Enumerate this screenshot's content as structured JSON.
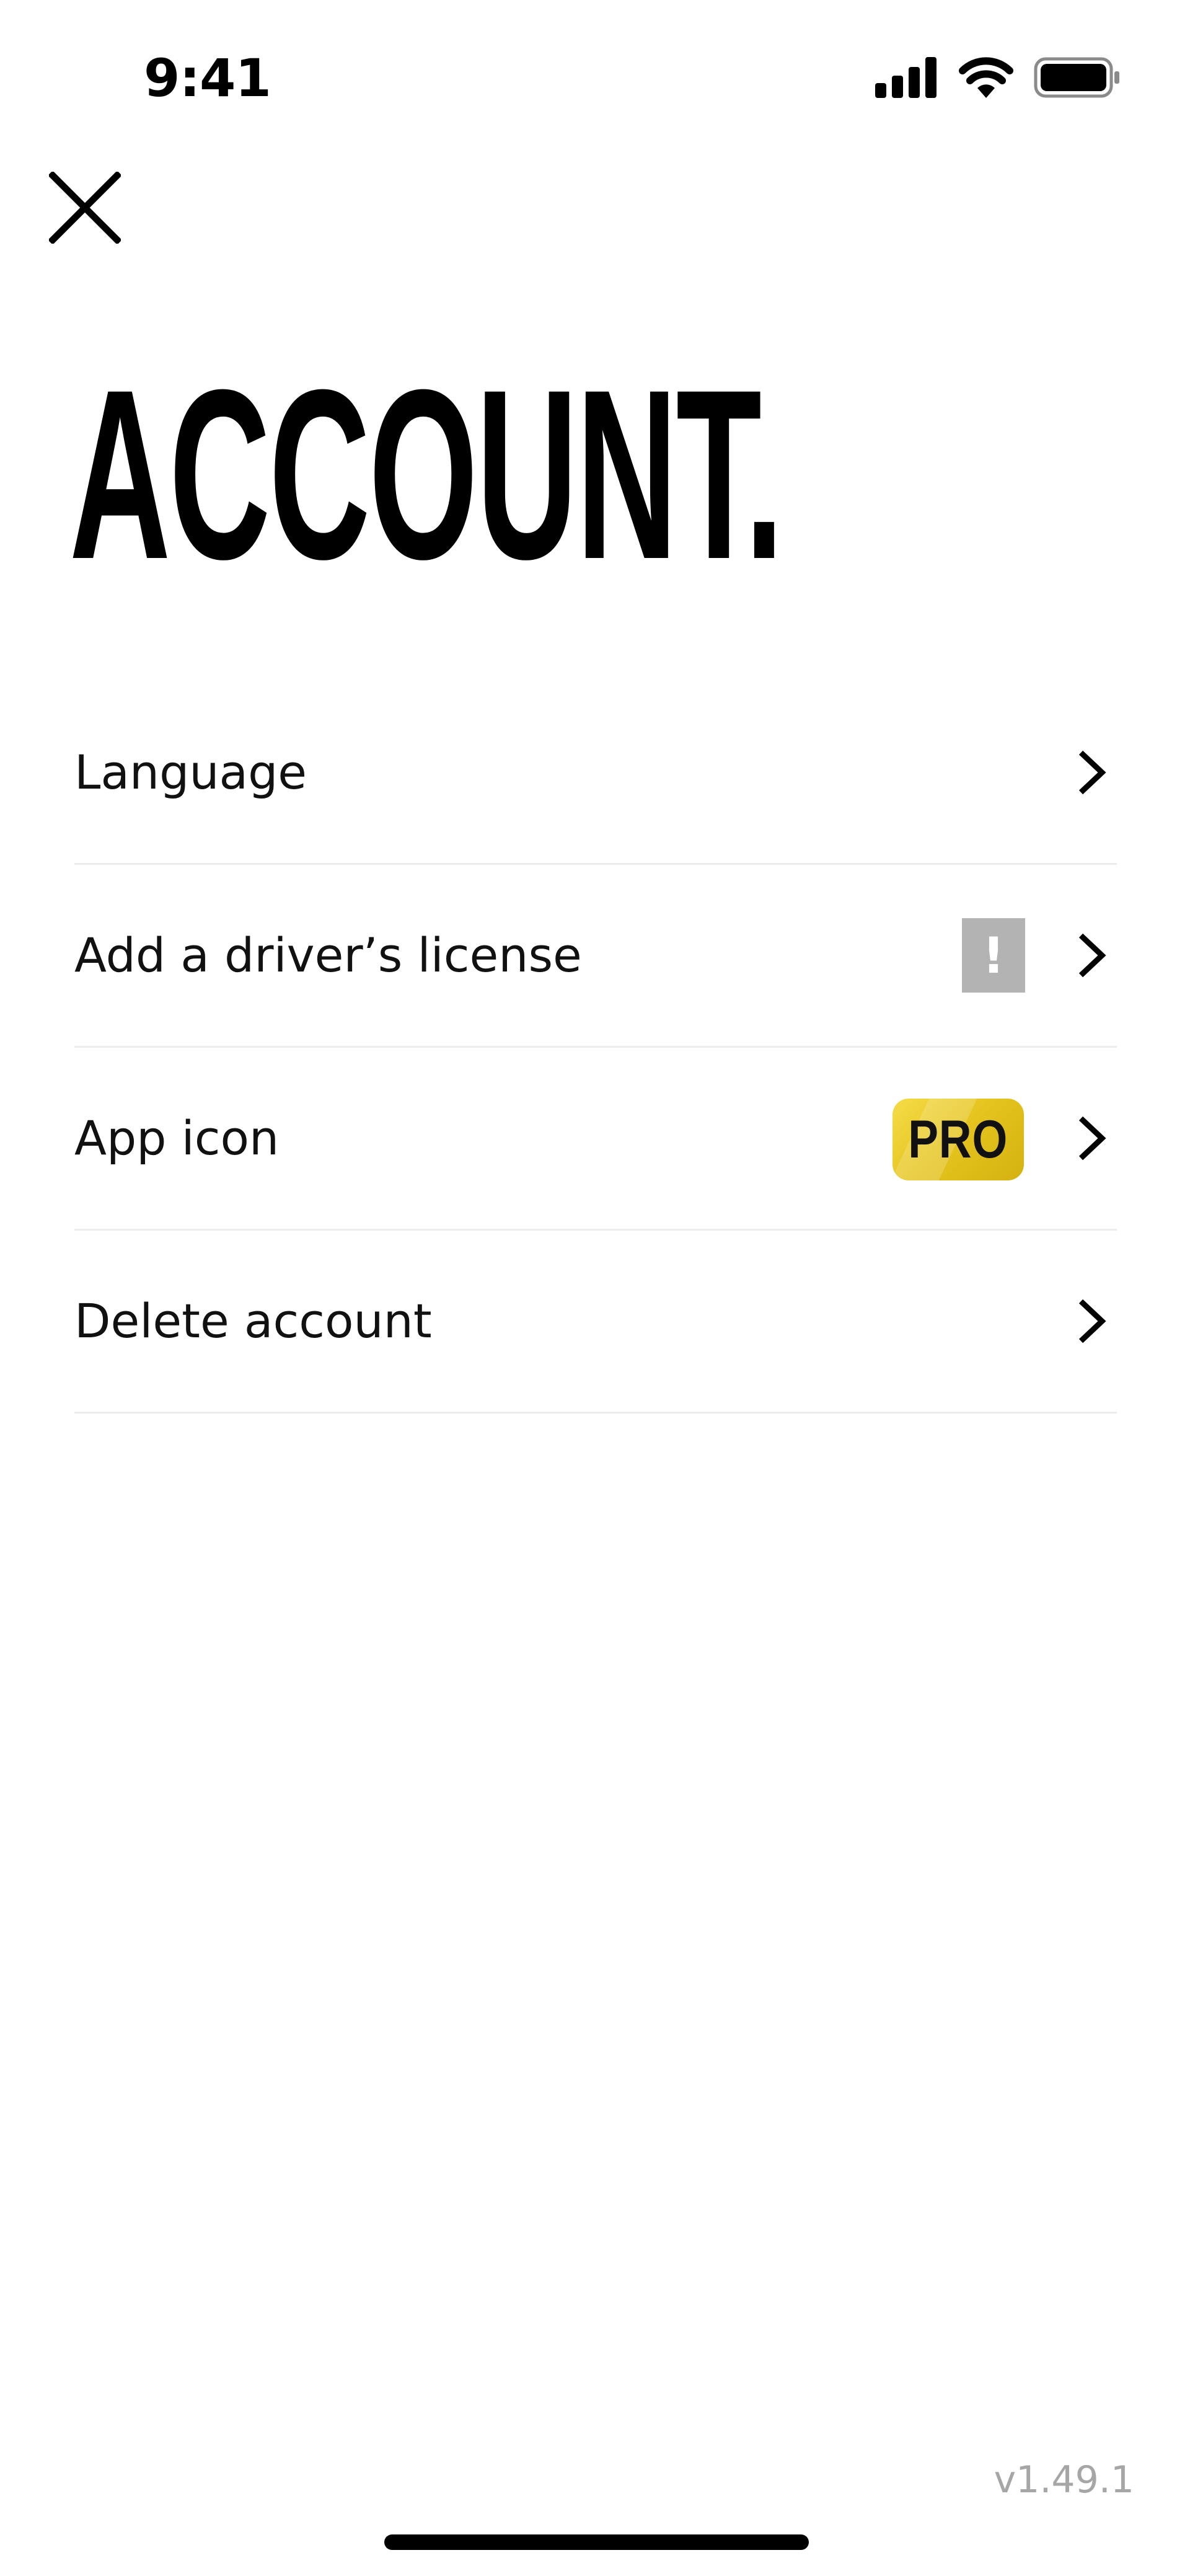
{
  "status_bar": {
    "time": "9:41"
  },
  "header": {
    "close_icon": "close-icon",
    "title": "ACCOUNT."
  },
  "menu": {
    "items": [
      {
        "label": "Language",
        "icon": "chevron-right-icon"
      },
      {
        "label": "Add a driver’s license",
        "badge": "!",
        "badge_color": "#b3b3b3",
        "icon": "chevron-right-icon"
      },
      {
        "label": "App icon",
        "badge": "PRO",
        "badge_color": "#e6c520",
        "icon": "chevron-right-icon"
      },
      {
        "label": "Delete account",
        "icon": "chevron-right-icon"
      }
    ]
  },
  "footer": {
    "version": "v1.49.1"
  }
}
